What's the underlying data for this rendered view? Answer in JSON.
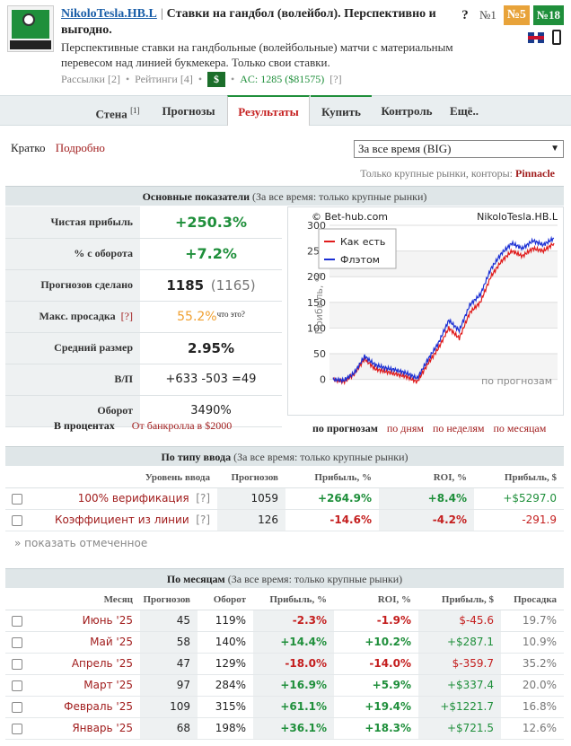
{
  "header": {
    "name": "NikoloTesla.HB.L",
    "separator": "|",
    "title": "Ставки на гандбол (волейбол). Перспективно и выгодно.",
    "description": "Перспективные ставки на гандбольные (волейбольные) матчи с материальным перевесом над линией букмекера. Только свои ставки.",
    "mailings": "Рассылки [2]",
    "ratings": "Рейтинги [4]",
    "dollar": "$",
    "ac": "AC: 1285 ($81575)",
    "help": "[?]",
    "qmark": "?",
    "rank1": "№1",
    "rank2": "№5",
    "rank3": "№18"
  },
  "nav": {
    "wall": "Стена",
    "wall_count": "[1]",
    "forecasts": "Прогнозы",
    "results": "Результаты",
    "buy": "Купить",
    "control": "Контроль",
    "more": "Ещё.."
  },
  "controls": {
    "brief": "Кратко",
    "detailed": "Подробно",
    "period": "За все время (BIG)",
    "markets_note": "Только крупные рынки, конторы:",
    "bookmaker": "Pinnacle"
  },
  "main_panel": {
    "title": "Основные показатели",
    "subtitle": "(За все время: только крупные рынки)",
    "stats": [
      {
        "label": "Чистая прибыль",
        "value": "+250.3%"
      },
      {
        "label": "% с оборота",
        "value": "+7.2%"
      },
      {
        "label": "Прогнозов сделано",
        "value": "1185",
        "extra": "(1165)"
      },
      {
        "label": "Макс. просадка",
        "help": "[?]",
        "value": "55.2%",
        "extra": "что это?"
      },
      {
        "label": "Средний размер",
        "value": "2.95%"
      },
      {
        "label": "В/П",
        "value": "+633 -503 =49"
      },
      {
        "label": "Оборот",
        "value": "3490%"
      }
    ],
    "percents_label": "В процентах",
    "bankroll_label": "От банкролла в $2000",
    "granularity": [
      "по прогнозам",
      "по дням",
      "по неделям",
      "по месяцам"
    ]
  },
  "chart_data": {
    "type": "line",
    "title": "NikoloTesla.HB.L",
    "source": "© Bet-hub.com",
    "ylabel": "Прибыль, %",
    "xlabel": "по прогнозам",
    "ylim": [
      -20,
      300
    ],
    "yticks": [
      0,
      50,
      100,
      150,
      200,
      250,
      300
    ],
    "legend_position": "top-left",
    "grid": true,
    "series": [
      {
        "name": "Как есть",
        "color": "#e01b1b",
        "values": [
          0,
          -5,
          10,
          40,
          20,
          15,
          10,
          5,
          -5,
          30,
          60,
          100,
          80,
          130,
          150,
          200,
          230,
          250,
          240,
          255,
          250,
          265
        ]
      },
      {
        "name": "Флэтом",
        "color": "#1b2fd4",
        "values": [
          0,
          -2,
          12,
          45,
          28,
          22,
          18,
          12,
          2,
          38,
          70,
          115,
          95,
          145,
          165,
          215,
          245,
          265,
          255,
          270,
          262,
          275
        ]
      }
    ]
  },
  "input_panel": {
    "title": "По типу ввода",
    "subtitle": "(За все время: только крупные рынки)",
    "headers": [
      "Уровень ввода",
      "Прогнозов",
      "Прибыль, %",
      "ROI, %",
      "Прибыль, $"
    ],
    "rows": [
      {
        "name": "100% верификация",
        "help": "[?]",
        "count": "1059",
        "profit": "+264.9%",
        "roi": "+8.4%",
        "usd": "+$5297.0"
      },
      {
        "name": "Коэффициент из линии",
        "help": "[?]",
        "count": "126",
        "profit": "-14.6%",
        "roi": "-4.2%",
        "usd": "-291.9"
      }
    ],
    "show_marked": "» показать отмеченное"
  },
  "month_panel": {
    "title": "По месяцам",
    "subtitle": "(За все время: только крупные рынки)",
    "headers": [
      "Месяц",
      "Прогнозов",
      "Оборот",
      "Прибыль, %",
      "ROI, %",
      "Прибыль, $",
      "Просадка"
    ],
    "rows": [
      {
        "month": "Июнь '25",
        "count": "45",
        "turnover": "119%",
        "profit": "-2.3%",
        "roi": "-1.9%",
        "usd": "$-45.6",
        "dd": "19.7%"
      },
      {
        "month": "Май '25",
        "count": "58",
        "turnover": "140%",
        "profit": "+14.4%",
        "roi": "+10.2%",
        "usd": "+$287.1",
        "dd": "10.9%"
      },
      {
        "month": "Апрель '25",
        "count": "47",
        "turnover": "129%",
        "profit": "-18.0%",
        "roi": "-14.0%",
        "usd": "$-359.7",
        "dd": "35.2%"
      },
      {
        "month": "Март '25",
        "count": "97",
        "turnover": "284%",
        "profit": "+16.9%",
        "roi": "+5.9%",
        "usd": "+$337.4",
        "dd": "20.0%"
      },
      {
        "month": "Февраль '25",
        "count": "109",
        "turnover": "315%",
        "profit": "+61.1%",
        "roi": "+19.4%",
        "usd": "+$1221.7",
        "dd": "16.8%"
      },
      {
        "month": "Январь '25",
        "count": "68",
        "turnover": "198%",
        "profit": "+36.1%",
        "roi": "+18.3%",
        "usd": "+$721.5",
        "dd": "12.6%"
      }
    ]
  }
}
